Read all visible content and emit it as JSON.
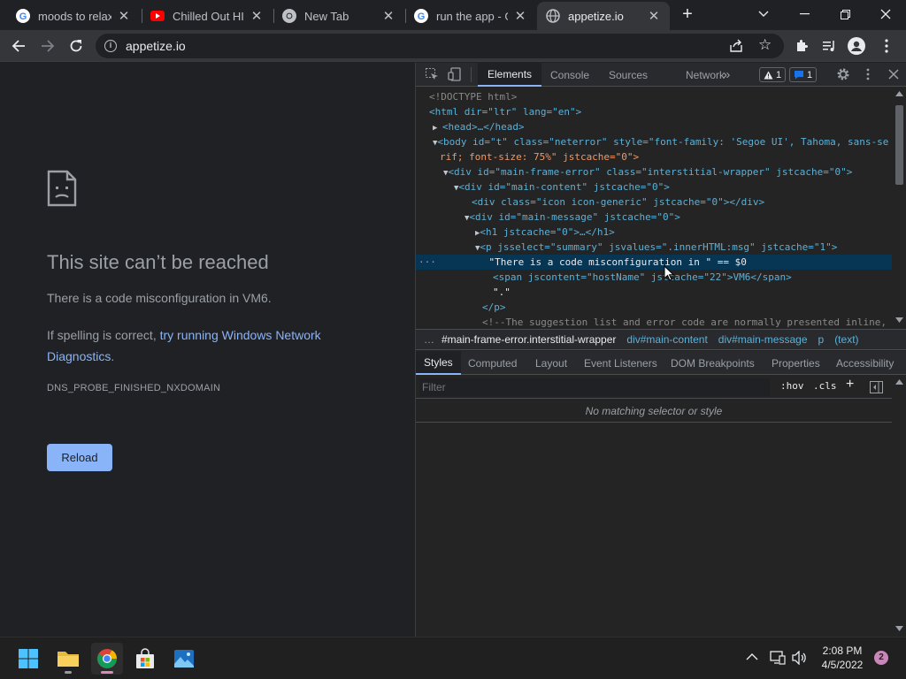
{
  "browser": {
    "tabs": [
      {
        "title": "moods to relaxa",
        "favicon": "google-icon"
      },
      {
        "title": "Chilled Out HIP",
        "favicon": "youtube-icon"
      },
      {
        "title": "New Tab",
        "favicon": "chrome-icon"
      },
      {
        "title": "run the app - Go",
        "favicon": "google-icon"
      },
      {
        "title": "appetize.io",
        "favicon": "globe-icon"
      }
    ],
    "new_tab": "+",
    "address": "appetize.io"
  },
  "page": {
    "title": "This site can’t be reached",
    "summary": "There is a code misconfiguration in VM6.",
    "suggest_prefix": "If spelling is correct, ",
    "suggest_link": "try running Windows Network Diagnostics",
    "suggest_suffix": ".",
    "error_code": "DNS_PROBE_FINISHED_NXDOMAIN",
    "reload_label": "Reload"
  },
  "devtools": {
    "tabs": [
      "Elements",
      "Console",
      "Sources",
      "Network"
    ],
    "more_tabs": "»",
    "warnings": "1",
    "messages": "1",
    "dom": [
      {
        "text": "<!DOCTYPE html>"
      },
      {
        "text": "<html dir=\"ltr\" lang=\"en\">"
      },
      {
        "text": "<head>…</head>"
      },
      {
        "text": "<body id=\"t\" class=\"neterror\" style=\"font-family: 'Segoe UI', Tahoma, sans-se"
      },
      {
        "text": "rif; font-size: 75%\" jstcache=\"0\">"
      },
      {
        "text": "<div id=\"main-frame-error\" class=\"interstitial-wrapper\" jstcache=\"0\">"
      },
      {
        "text": "<div id=\"main-content\" jstcache=\"0\">"
      },
      {
        "text": "<div class=\"icon icon-generic\" jstcache=\"0\"></div>"
      },
      {
        "text": "<div id=\"main-message\" jstcache=\"0\">"
      },
      {
        "text": "<h1 jstcache=\"0\">…</h1>"
      },
      {
        "text": "<p jsselect=\"summary\" jsvalues=\".innerHTML:msg\" jstcache=\"1\">"
      },
      {
        "text": "\"There is a code misconfiguration in \" == $0"
      },
      {
        "text": "<span jscontent=\"hostName\" jstcache=\"22\">VM6</span>"
      },
      {
        "text": "\".\""
      },
      {
        "text": "</p>"
      },
      {
        "text": "<!--The suggestion list and error code are normally presented inline,"
      }
    ],
    "breadcrumbs": [
      "#main-frame-error.interstitial-wrapper",
      "div#main-content",
      "div#main-message",
      "p",
      "(text)"
    ],
    "breadcrumb_more": "…",
    "styles_tabs": [
      "Styles",
      "Computed",
      "Layout",
      "Event Listeners",
      "DOM Breakpoints",
      "Properties",
      "Accessibility"
    ],
    "filter_placeholder": "Filter",
    "hov": ":hov",
    "cls": ".cls",
    "no_match": "No matching selector or style"
  },
  "taskbar": {
    "time": "2:08 PM",
    "date": "4/5/2022",
    "notifications": "2"
  },
  "colors": {
    "link": "#8ab4f8",
    "selection": "#073655",
    "tag": "#5db0d7",
    "attr_value": "#f29766"
  }
}
